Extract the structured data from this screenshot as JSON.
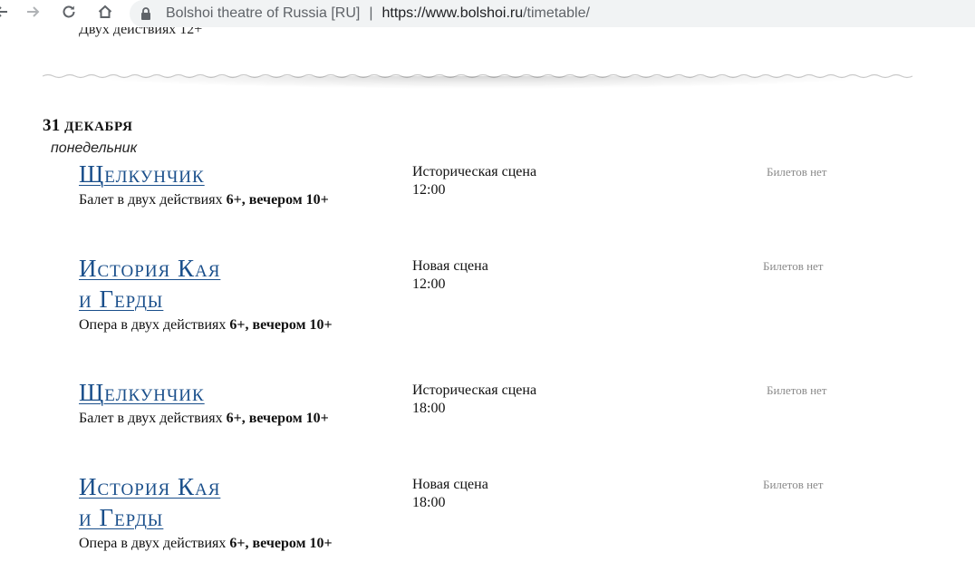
{
  "browser": {
    "site_name": "Bolshoi theatre of Russia [RU]",
    "separator": "|",
    "url_host": "https://www.bolshoi.ru",
    "url_path": "/timetable/"
  },
  "page": {
    "cutoff_text": "Двух действиях 12+"
  },
  "schedule": {
    "date_number": "31",
    "date_month": "ДЕКАБРЯ",
    "weekday": "понедельник",
    "events": [
      {
        "title_line1": "Щелкунчик",
        "title_line2": "",
        "desc_main": "Балет в двух действиях ",
        "desc_bold": "6+, вечером 10+",
        "venue": "Историческая сцена",
        "time": "12:00",
        "tickets": "Билетов нет"
      },
      {
        "title_line1": "История Кая",
        "title_line2": "и Герды",
        "desc_main": "Опера в двух действиях ",
        "desc_bold": "6+, вечером 10+",
        "venue": "Новая сцена",
        "time": "12:00",
        "tickets": "Билетов нет"
      },
      {
        "title_line1": "Щелкунчик",
        "title_line2": "",
        "desc_main": "Балет в двух действиях ",
        "desc_bold": "6+, вечером 10+",
        "venue": "Историческая сцена",
        "time": "18:00",
        "tickets": "Билетов нет"
      },
      {
        "title_line1": "История Кая",
        "title_line2": "и Герды",
        "desc_main": "Опера в двух действиях ",
        "desc_bold": "6+, вечером 10+",
        "venue": "Новая сцена",
        "time": "18:00",
        "tickets": "Билетов нет"
      }
    ]
  }
}
